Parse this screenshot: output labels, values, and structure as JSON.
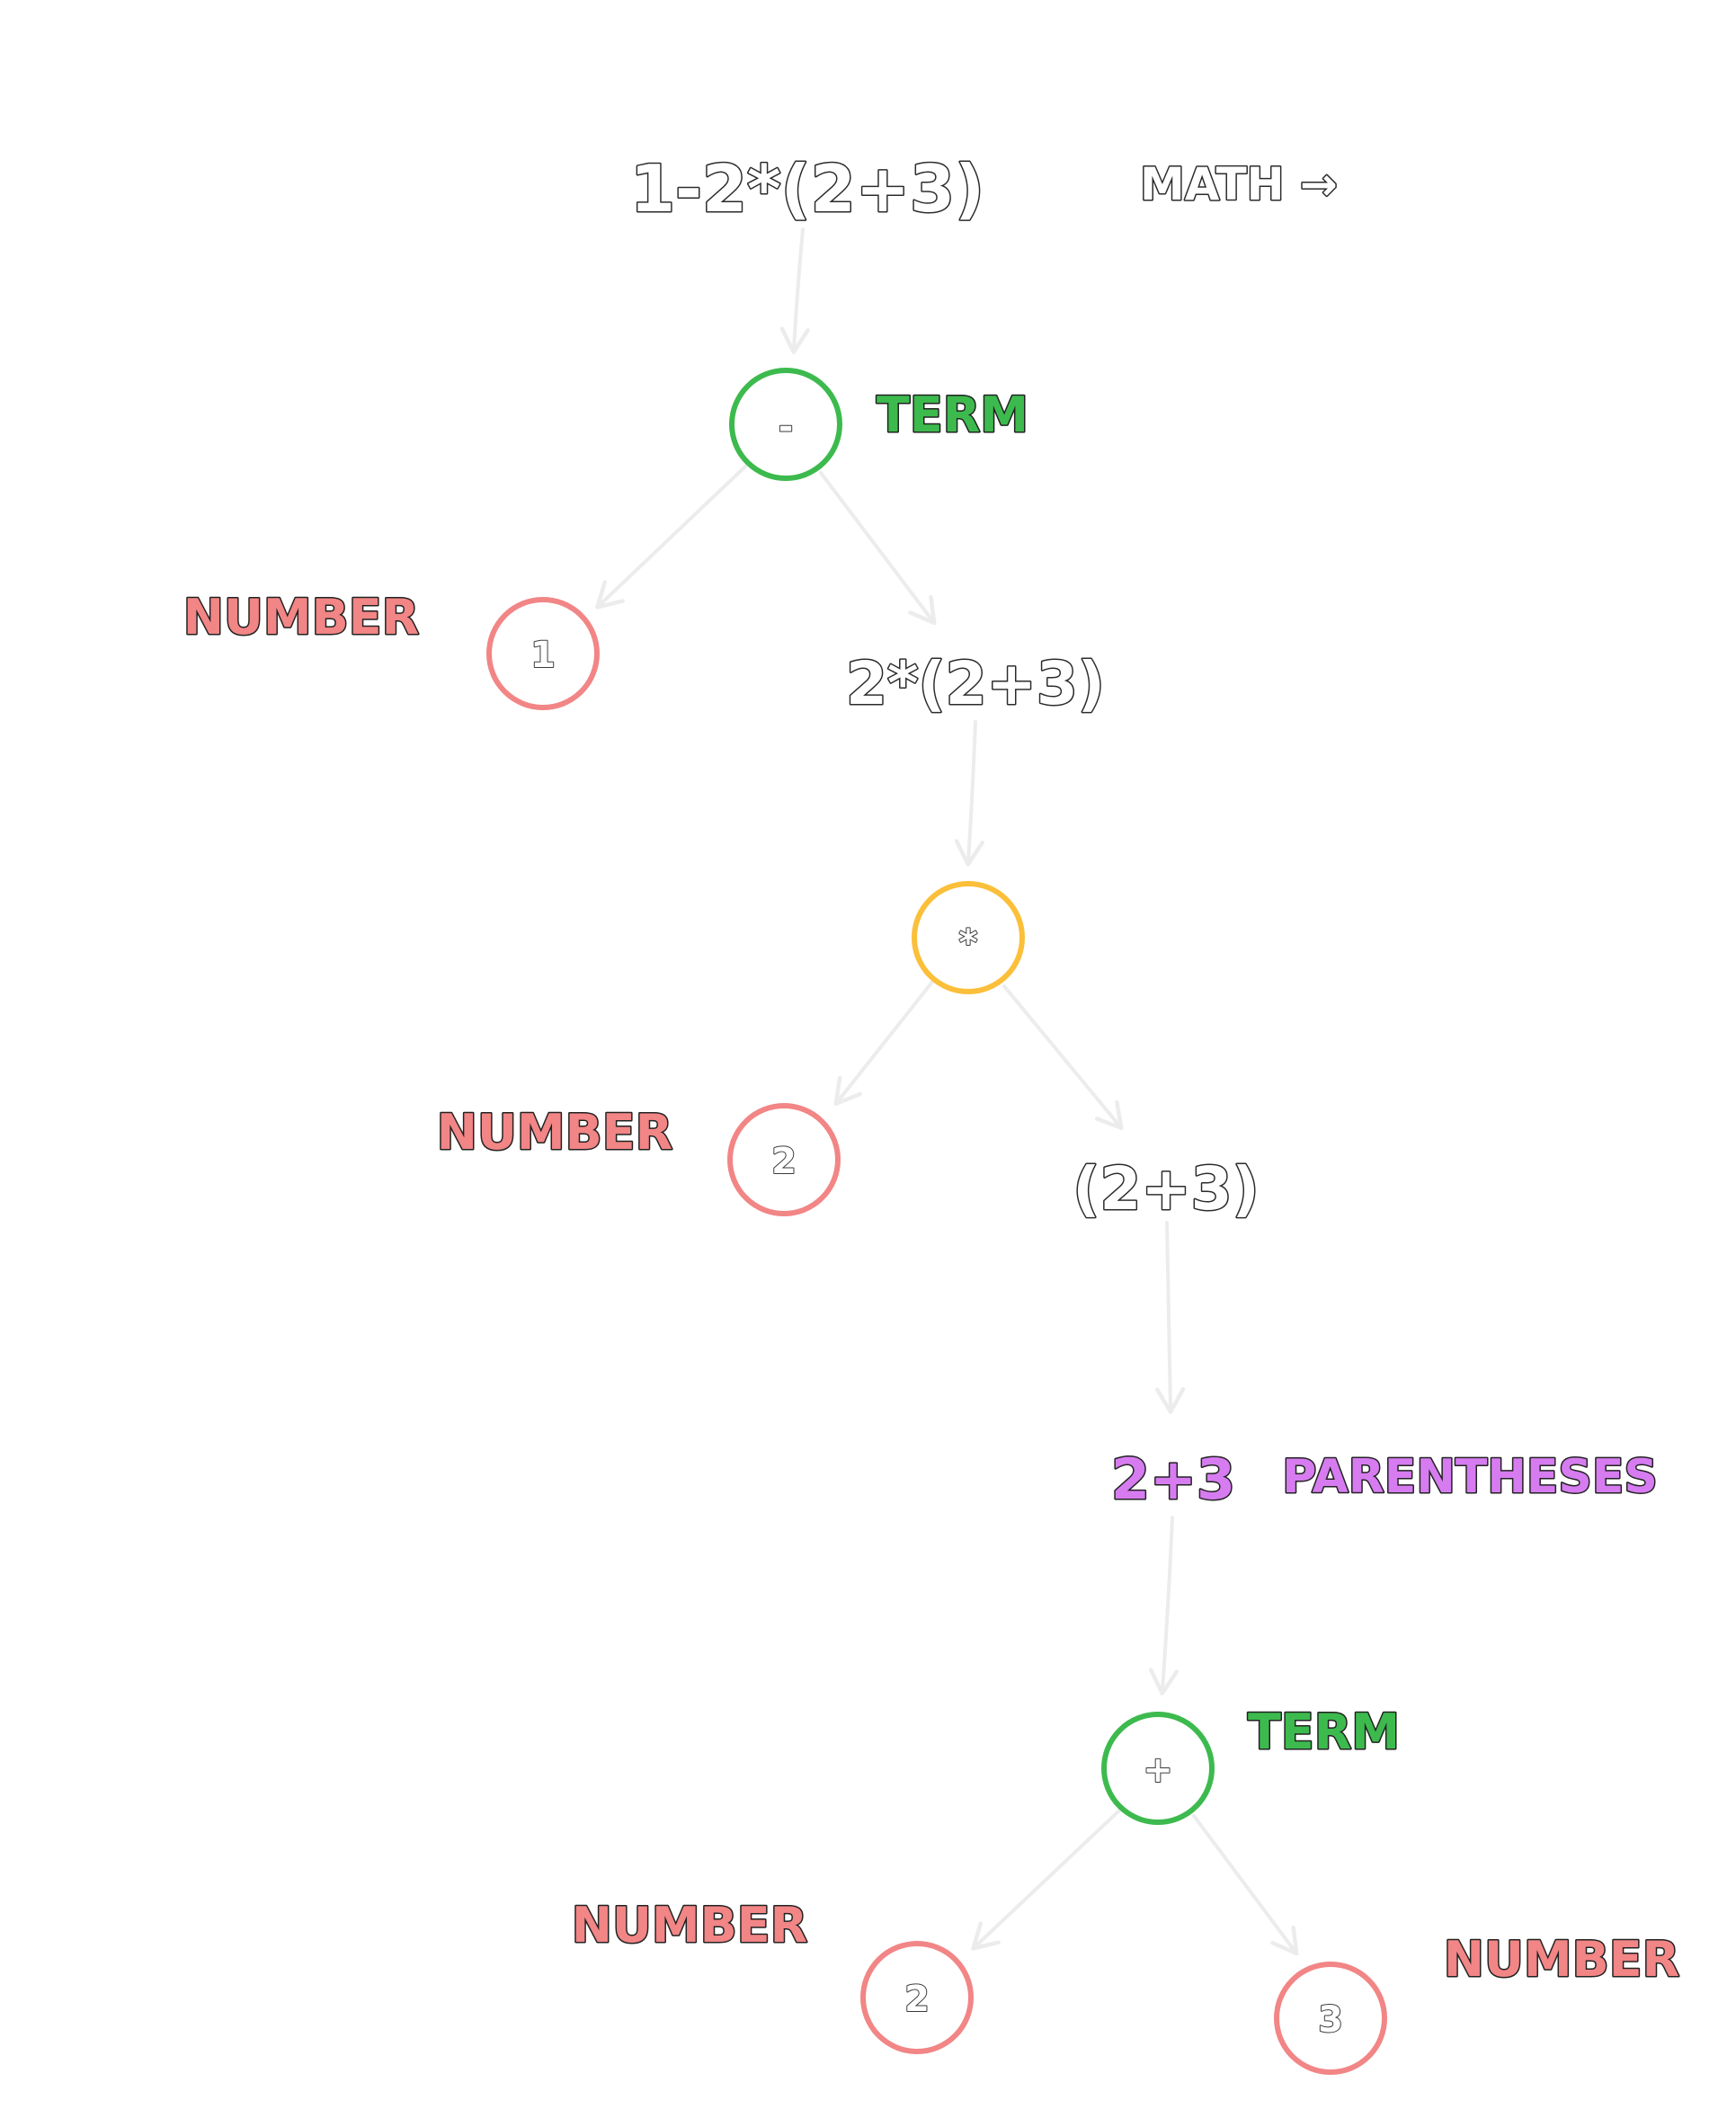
{
  "colors": {
    "term": "#3dba4e",
    "number": "#f28585",
    "product": "#fbbf3a",
    "parentheses": "#d67cf0",
    "edge": "#ececec"
  },
  "expressions": {
    "root": "1-2*(2+3)",
    "math_label": "MATH →",
    "product_expr": "2*(2+3)",
    "paren_expr": "(2+3)",
    "inner_expr": "2+3"
  },
  "nodes": {
    "minus": "-",
    "one": "1",
    "times": "*",
    "two_a": "2",
    "plus": "+",
    "two_b": "2",
    "three": "3"
  },
  "tags": {
    "term_top": "TERM",
    "number_one": "NUMBER",
    "number_two_a": "NUMBER",
    "parentheses": "PARENTHESES",
    "term_bottom": "TERM",
    "number_two_b": "NUMBER",
    "number_three": "NUMBER"
  }
}
